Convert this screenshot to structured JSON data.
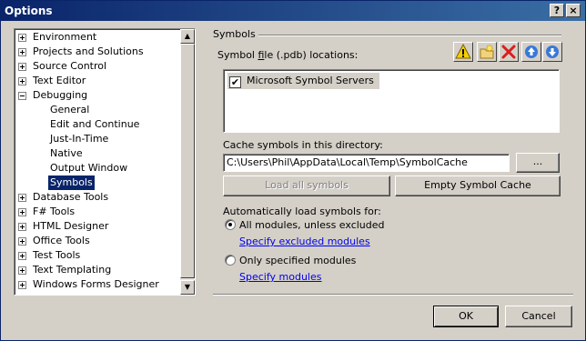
{
  "window": {
    "title": "Options",
    "help_glyph": "?",
    "close_glyph": "×"
  },
  "tree": {
    "items": [
      {
        "label": "Environment",
        "expander": "plus"
      },
      {
        "label": "Projects and Solutions",
        "expander": "plus"
      },
      {
        "label": "Source Control",
        "expander": "plus"
      },
      {
        "label": "Text Editor",
        "expander": "plus"
      },
      {
        "label": "Debugging",
        "expander": "minus"
      },
      {
        "label": "General",
        "child": true
      },
      {
        "label": "Edit and Continue",
        "child": true
      },
      {
        "label": "Just-In-Time",
        "child": true
      },
      {
        "label": "Native",
        "child": true
      },
      {
        "label": "Output Window",
        "child": true
      },
      {
        "label": "Symbols",
        "child": true,
        "selected": true
      },
      {
        "label": "Database Tools",
        "expander": "plus"
      },
      {
        "label": "F# Tools",
        "expander": "plus"
      },
      {
        "label": "HTML Designer",
        "expander": "plus"
      },
      {
        "label": "Office Tools",
        "expander": "plus"
      },
      {
        "label": "Test Tools",
        "expander": "plus"
      },
      {
        "label": "Text Templating",
        "expander": "plus"
      },
      {
        "label": "Windows Forms Designer",
        "expander": "plus"
      }
    ]
  },
  "symbols": {
    "group_title": "Symbols",
    "locations_label_pre": "Symbol ",
    "locations_label_ul": "f",
    "locations_label_post": "ile (.pdb) locations:",
    "toolbar_icons": [
      "warning-icon",
      "new-folder-icon",
      "delete-icon",
      "move-up-icon",
      "move-down-icon"
    ],
    "locations": [
      {
        "label": "Microsoft Symbol Servers",
        "checked": true
      }
    ],
    "cache_label": "Cache symbols in this directory:",
    "cache_path": "C:\\Users\\Phil\\AppData\\Local\\Temp\\SymbolCache",
    "browse_label": "...",
    "load_all_label": "Load all symbols",
    "empty_cache_label": "Empty Symbol Cache",
    "auto_load_label": "Automatically load symbols for:",
    "option_all": "All modules, unless excluded",
    "option_all_selected": true,
    "link_excluded": "Specify excluded modules",
    "option_only": "Only specified modules",
    "option_only_selected": false,
    "link_specify": "Specify modules"
  },
  "footer": {
    "ok_label": "OK",
    "cancel_label": "Cancel"
  },
  "colors": {
    "titlebar_start": "#0a246a",
    "titlebar_end": "#3a6ea5",
    "face": "#d4d0c8",
    "selection": "#0a246a",
    "link": "#0000ee"
  }
}
